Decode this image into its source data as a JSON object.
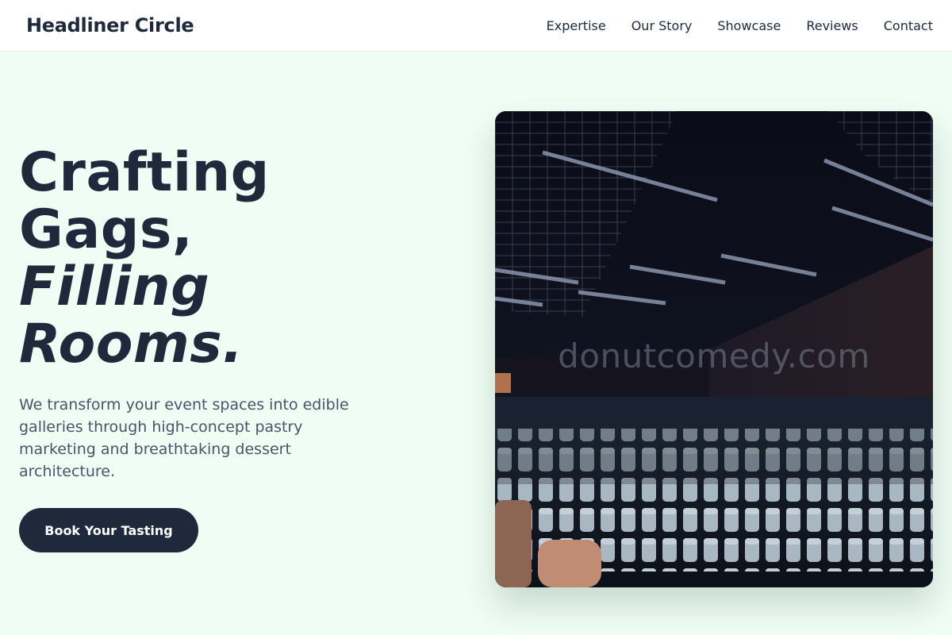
{
  "nav": {
    "brand": "Headliner Circle",
    "links": [
      "Expertise",
      "Our Story",
      "Showcase",
      "Reviews",
      "Contact"
    ]
  },
  "hero": {
    "headline": {
      "line1": "Crafting",
      "line2": "Gags,",
      "line3": "Filling",
      "line4": "Rooms."
    },
    "description": "We transform your event spaces into edible galleries through high-concept pastry marketing and breathtaking dessert architecture.",
    "cta_label": "Book Your Tasting",
    "image": {
      "subject": "empty banquet hall with rows of covered chairs",
      "watermark": "donutcomedy.com"
    }
  },
  "colors": {
    "background": "#effdf4",
    "primary": "#1e293b",
    "text_muted": "#475569",
    "nav_background": "#ffffff"
  }
}
